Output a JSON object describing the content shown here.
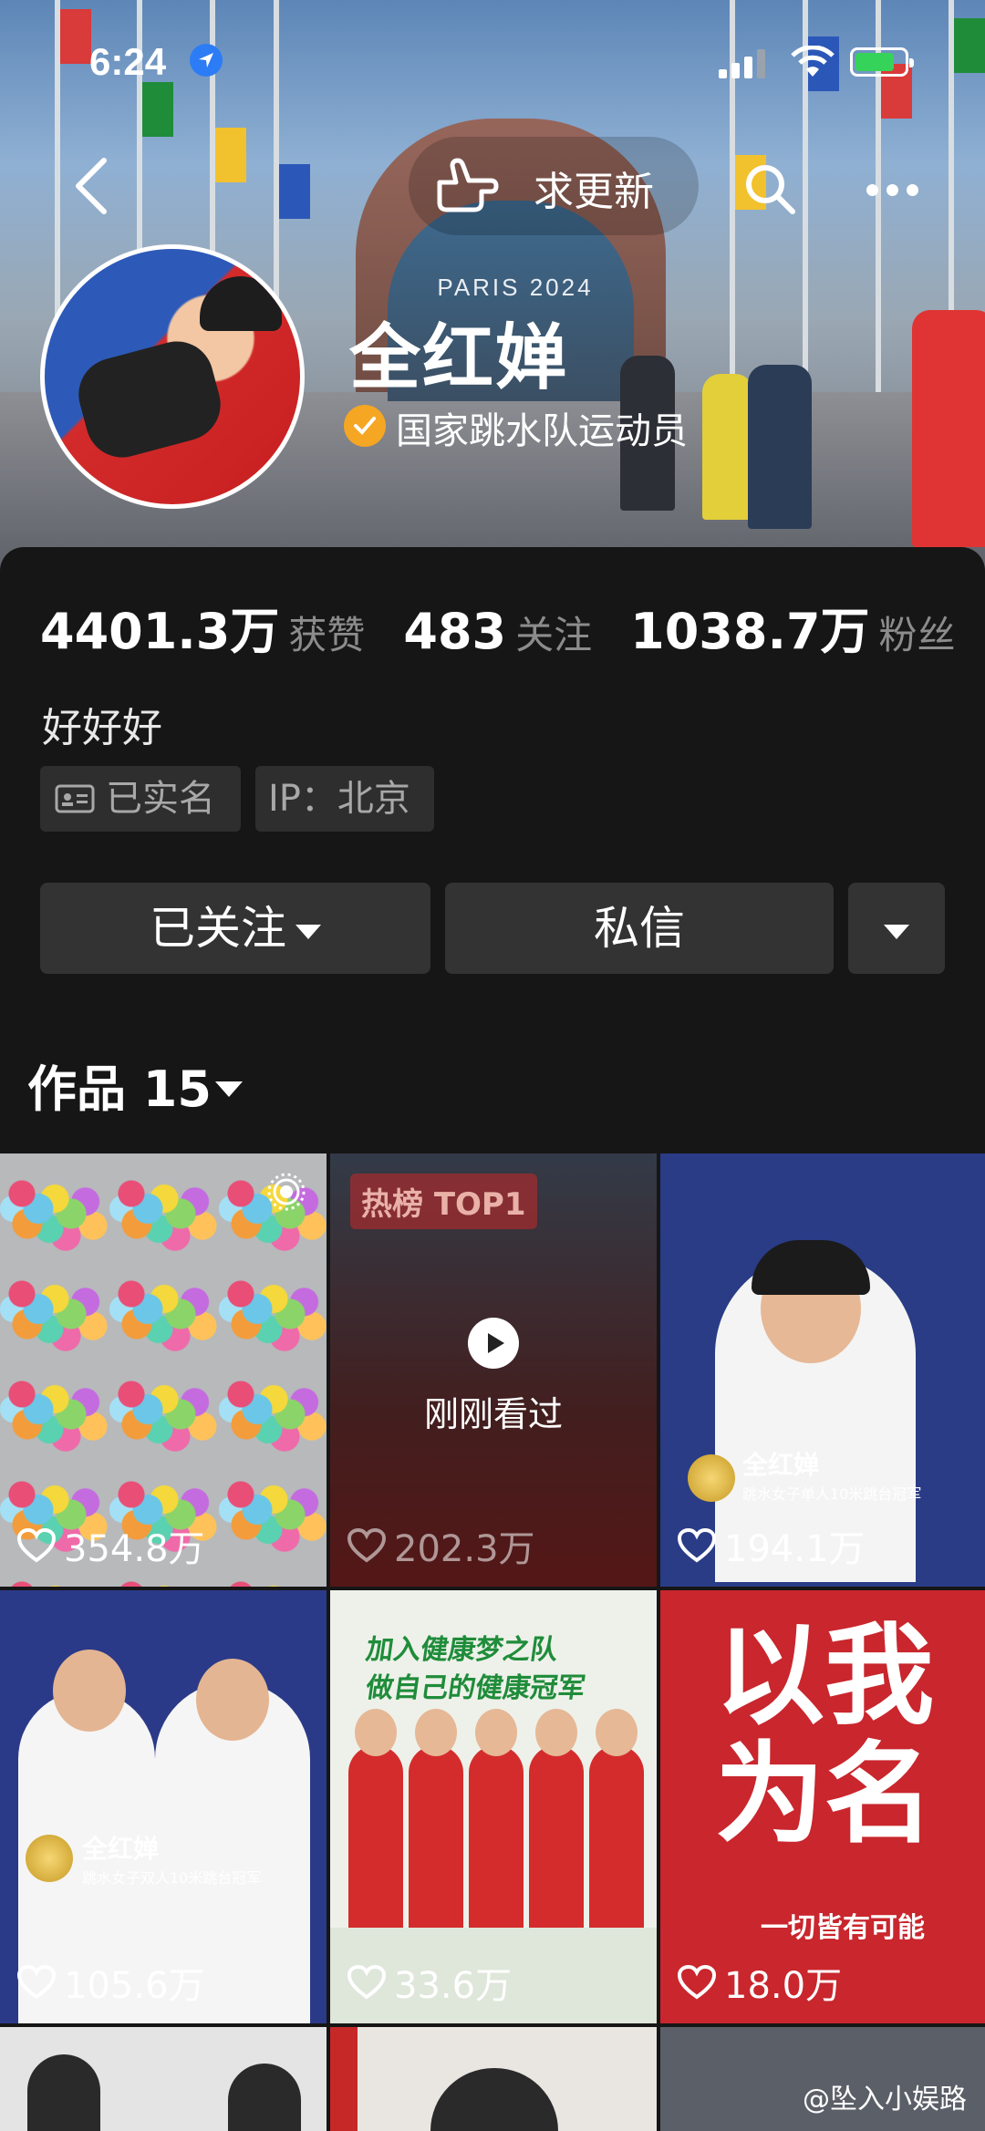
{
  "status_bar": {
    "time": "6:24"
  },
  "nav": {
    "refresh_label": "求更新"
  },
  "banner": {
    "building_text": "PARIS 2024"
  },
  "profile": {
    "name": "全红婵",
    "verify_text": "国家跳水队运动员",
    "stats": [
      {
        "value": "4401.3万",
        "label": "获赞"
      },
      {
        "value": "483",
        "label": "关注"
      },
      {
        "value": "1038.7万",
        "label": "粉丝"
      }
    ],
    "bio": "好好好",
    "tags": {
      "realname": "已实名",
      "ip": "IP：北京"
    }
  },
  "buttons": {
    "follow": "已关注",
    "message": "私信"
  },
  "works": {
    "label": "作品 15"
  },
  "videos": [
    {
      "likes": "354.8万"
    },
    {
      "likes": "202.3万",
      "badge": "热榜 TOP1",
      "overlay": "刚刚看过"
    },
    {
      "likes": "194.1万",
      "caption_name": "全红婵",
      "caption_sub": "跳水女子单人10米跳台冠军"
    },
    {
      "likes": "105.6万",
      "caption_name": "全红婵",
      "caption_sub": "跳水女子双人10米跳台冠军"
    },
    {
      "likes": "33.6万",
      "headline1": "加入健康梦之队",
      "headline2": "做自己的健康冠军"
    },
    {
      "likes": "18.0万",
      "big_text": "以我为名",
      "sub_text": "一切皆有可能"
    }
  ],
  "watermark": "@坠入小娱路",
  "colors": {
    "accent_green": "#36d35a",
    "verified": "#f5a623",
    "location": "#2c7cf6"
  }
}
